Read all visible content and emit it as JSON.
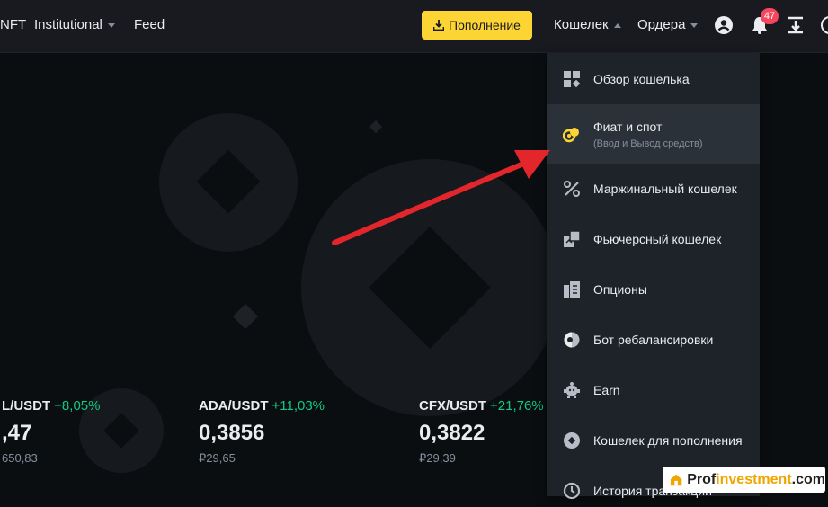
{
  "header": {
    "nav": [
      {
        "label": "NFT",
        "caret": false
      },
      {
        "label": "Institutional",
        "caret": true
      },
      {
        "label": "Feed",
        "caret": false
      }
    ],
    "deposit_label": "Пополнение",
    "wallet_label": "Кошелек",
    "orders_label": "Ордера",
    "notifications_count": "47",
    "icons": [
      "user-icon",
      "bell-icon",
      "download-icon",
      "globe-icon"
    ]
  },
  "tickers": [
    {
      "pair": "L/USDT",
      "change": "+8,05%",
      "price": ",47",
      "rub": "650,83"
    },
    {
      "pair": "ADA/USDT",
      "change": "+11,03%",
      "price": "0,3856",
      "rub": "₽29,65"
    },
    {
      "pair": "CFX/USDT",
      "change": "+21,76%",
      "price": "0,3822",
      "rub": "₽29,39"
    }
  ],
  "wallet_menu": {
    "items": [
      {
        "label": "Обзор кошелька",
        "icon": "grid-icon"
      },
      {
        "label": "Фиат и спот",
        "sublabel": "(Ввод и Вывод средств)",
        "icon": "coins-icon",
        "active": true
      },
      {
        "label": "Маржинальный кошелек",
        "icon": "percent-icon"
      },
      {
        "label": "Фьючерсный кошелек",
        "icon": "futures-icon"
      },
      {
        "label": "Опционы",
        "icon": "options-icon"
      },
      {
        "label": "Бот ребалансировки",
        "icon": "bot-icon"
      },
      {
        "label": "Earn",
        "icon": "piggy-icon"
      },
      {
        "label": "Кошелек для пополнения",
        "icon": "diamond-wallet-icon"
      },
      {
        "label": "История транзакций",
        "icon": "history-icon"
      }
    ]
  },
  "watermark": {
    "prefix": "Prof",
    "highlight": "investment",
    "suffix": ".com"
  },
  "colors": {
    "accent": "#fcd535",
    "positive": "#0ecb81",
    "badge": "#f6465d",
    "arrow": "#e3262b"
  }
}
